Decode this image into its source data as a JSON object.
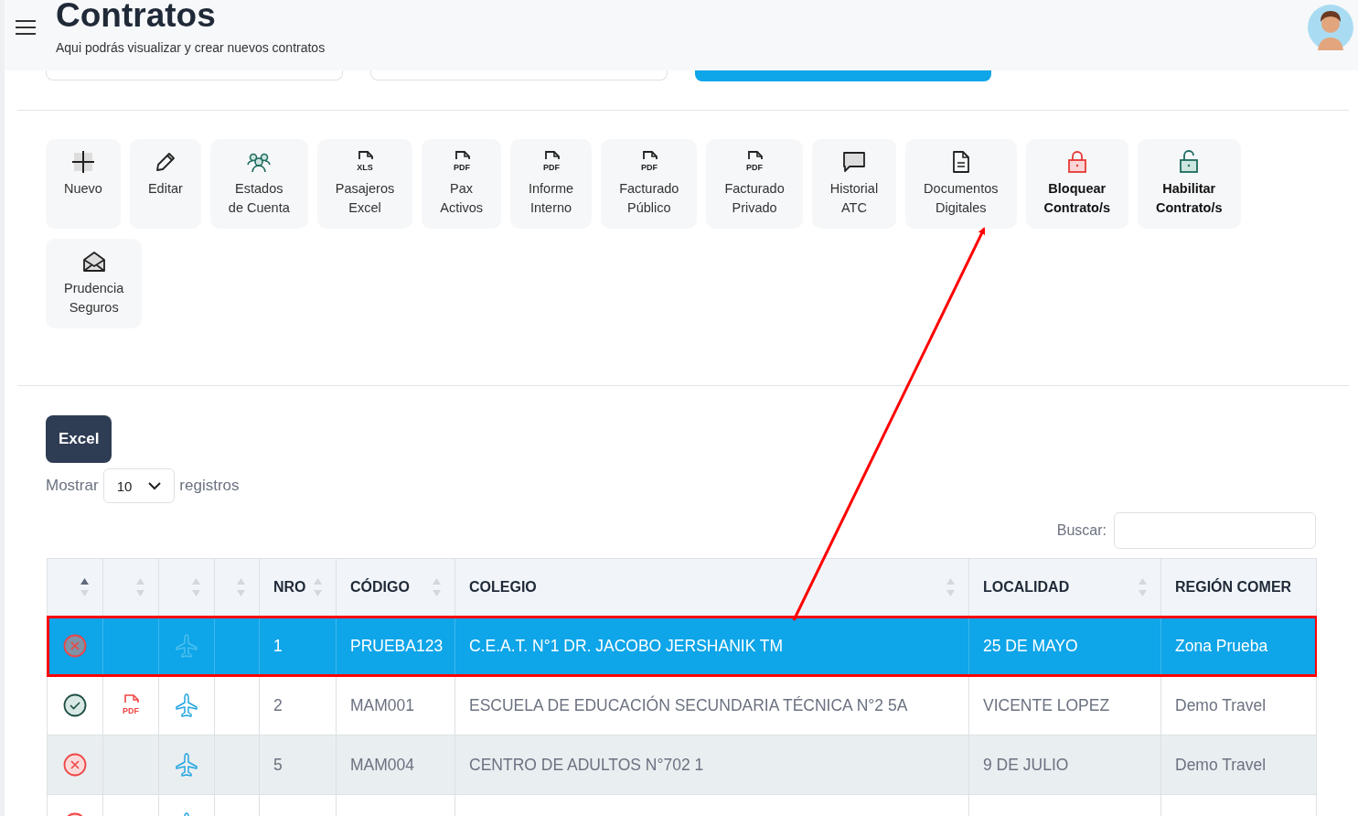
{
  "header": {
    "title": "Contratos",
    "subtitle": "Aqui podrás visualizar y crear nuevos contratos"
  },
  "actions": [
    {
      "kind": "plus",
      "lines": [
        "Nuevo"
      ],
      "emphasis": false
    },
    {
      "kind": "pencil",
      "lines": [
        "Editar"
      ],
      "emphasis": false
    },
    {
      "kind": "users",
      "lines": [
        "Estados",
        "de Cuenta"
      ],
      "emphasis": false
    },
    {
      "kind": "file",
      "badge": "XLS",
      "lines": [
        "Pasajeros",
        "Excel"
      ],
      "emphasis": false
    },
    {
      "kind": "file",
      "badge": "PDF",
      "lines": [
        "Pax",
        "Activos"
      ],
      "emphasis": false
    },
    {
      "kind": "file",
      "badge": "PDF",
      "lines": [
        "Informe",
        "Interno"
      ],
      "emphasis": false
    },
    {
      "kind": "file",
      "badge": "PDF",
      "lines": [
        "Facturado",
        "Público"
      ],
      "emphasis": false
    },
    {
      "kind": "file",
      "badge": "PDF",
      "lines": [
        "Facturado",
        "Privado"
      ],
      "emphasis": false
    },
    {
      "kind": "chat",
      "lines": [
        "Historial",
        "ATC"
      ],
      "emphasis": false
    },
    {
      "kind": "document",
      "lines": [
        "Documentos",
        "Digitales"
      ],
      "emphasis": false
    },
    {
      "kind": "lock",
      "lines": [
        "Bloquear",
        "Contrato/s"
      ],
      "emphasis": true
    },
    {
      "kind": "unlock",
      "lines": [
        "Habilitar",
        "Contrato/s"
      ],
      "emphasis": true
    },
    {
      "kind": "envelope",
      "lines": [
        "Prudencia",
        "Seguros"
      ],
      "emphasis": false
    }
  ],
  "excel_button": "Excel",
  "length": {
    "before": "Mostrar",
    "value": "10",
    "after": "registros"
  },
  "search": {
    "label": "Buscar:"
  },
  "table": {
    "columns": [
      {
        "sortable": true,
        "sorted": true
      },
      {
        "sortable": true,
        "sorted": false
      },
      {
        "sortable": true,
        "sorted": false
      },
      {
        "sortable": true,
        "sorted": false
      },
      {
        "label": "NRO",
        "sortable": true,
        "sorted": false
      },
      {
        "label": "CÓDIGO",
        "sortable": true,
        "sorted": false
      },
      {
        "label": "COLEGIO",
        "sortable": true,
        "sorted": false
      },
      {
        "label": "LOCALIDAD",
        "sortable": true,
        "sorted": false
      },
      {
        "label": "REGIÓN COMER",
        "sortable": false
      }
    ],
    "rows": [
      {
        "ok": false,
        "nro": "1",
        "codigo": "PRUEBA123",
        "colegio": "C.E.A.T. N°1 DR. JACOBO JERSHANIK TM",
        "localidad": "25 DE MAYO",
        "region": "Zona Prueba",
        "selected": true
      },
      {
        "ok": true,
        "pdf": "PDF",
        "nro": "2",
        "codigo": "MAM001",
        "colegio": "ESCUELA DE EDUCACIÓN SECUNDARIA TÉCNICA N°2 5A",
        "localidad": "VICENTE LOPEZ",
        "region": "Demo Travel",
        "selected": false
      },
      {
        "ok": false,
        "nro": "5",
        "codigo": "MAM004",
        "colegio": "CENTRO DE ADULTOS N°702 1",
        "localidad": "9 DE JULIO",
        "region": "Demo Travel",
        "selected": false
      },
      {
        "ok": false,
        "selected": false
      }
    ]
  }
}
